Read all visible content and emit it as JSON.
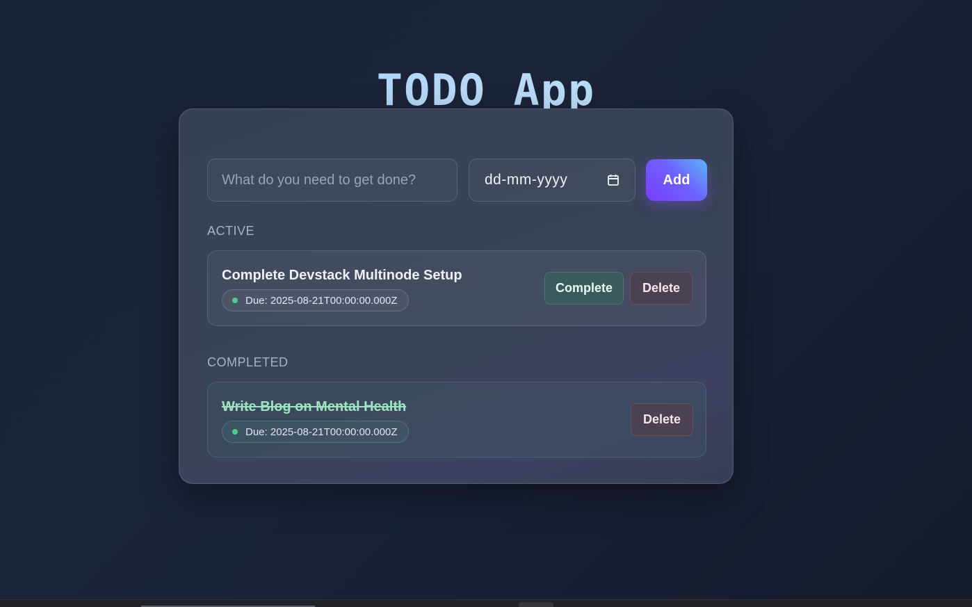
{
  "app": {
    "title": "TODO App"
  },
  "form": {
    "task_placeholder": "What do you need to get done?",
    "date_placeholder": "dd-mm-yyyy",
    "date_icon": "calendar-icon",
    "add_label": "Add"
  },
  "sections": {
    "active_label": "ACTIVE",
    "completed_label": "COMPLETED"
  },
  "active_todos": [
    {
      "title": "Complete Devstack Multinode Setup",
      "due": "Due: 2025-08-21T00:00:00.000Z",
      "complete_label": "Complete",
      "delete_label": "Delete"
    }
  ],
  "completed_todos": [
    {
      "title": "Write Blog on Mental Health",
      "due": "Due: 2025-08-21T00:00:00.000Z",
      "delete_label": "Delete"
    }
  ],
  "colors": {
    "accent_gradient_start": "#7a3dff",
    "accent_gradient_end": "#5bb6f7",
    "status_dot": "#4ccb8a",
    "completed_text": "#9fe3c2"
  }
}
